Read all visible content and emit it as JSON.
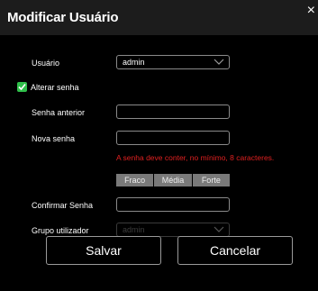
{
  "dialog": {
    "title": "Modificar Usuário",
    "close_icon": "×"
  },
  "form": {
    "user_label": "Usuário",
    "user_value": "admin",
    "change_password_label": "Alterar senha",
    "change_password_checked": true,
    "old_password_label": "Senha anterior",
    "old_password_value": "",
    "new_password_label": "Nova senha",
    "new_password_value": "",
    "password_hint": "A senha deve conter, no mínimo, 8 caracteres.",
    "strength_levels": [
      "Fraco",
      "Média",
      "Forte"
    ],
    "confirm_password_label": "Confirmar Senha",
    "confirm_password_value": "",
    "group_label": "Grupo utilizador",
    "group_value": "admin"
  },
  "actions": {
    "save_label": "Salvar",
    "cancel_label": "Cancelar"
  },
  "colors": {
    "background": "#000000",
    "title_bar": "#1c1c1c",
    "checkbox": "#2fbf4a",
    "error": "#e02020",
    "strength_bar": "#7a7a7a"
  }
}
